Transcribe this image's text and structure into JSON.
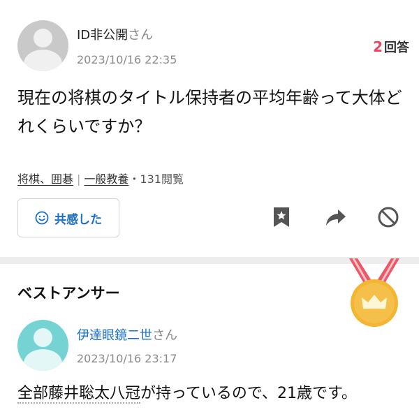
{
  "question": {
    "asker_name": "ID非公開",
    "asker_honorific": "さん",
    "date": "2023/10/16 22:35",
    "answer_count": "2",
    "answer_count_label": "回答",
    "text": "現在の将棋のタイトル保持者の平均年齢って大体どれくらいですか？",
    "tags": [
      "将棋、囲碁",
      "一般教養"
    ],
    "tag_separator": "|",
    "views": "・131閲覧",
    "empathy_label": "共感した"
  },
  "icons": {
    "avatar": "default-user-avatar",
    "empathy": "smile-icon",
    "bookmark": "bookmark-star-icon",
    "share": "share-arrow-icon",
    "report": "ban-icon",
    "medal": "crown-medal-icon"
  },
  "colors": {
    "accent_blue": "#1a6ec7",
    "answer_count_red": "#e8475f",
    "medal_gold": "#f2b632",
    "ribbon_red": "#e85a6a",
    "answerer_avatar": "#76d3d4"
  },
  "best_answer": {
    "title": "ベストアンサー",
    "answerer_name": "伊達眼鏡二世",
    "answerer_honorific": "さん",
    "date": "2023/10/16 23:17",
    "text_linked": "全部藤井聡太八冠",
    "text_rest": "が持っているので、21歳です。"
  }
}
